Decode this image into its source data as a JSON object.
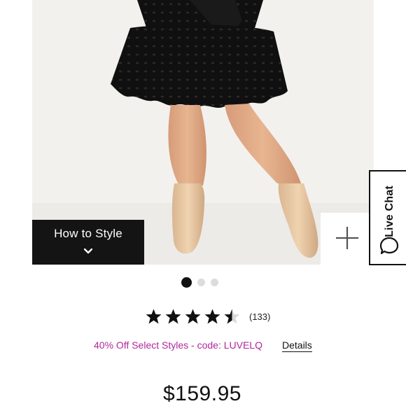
{
  "product_image": {
    "alt": "Model wearing black eyelet dress with nude boots"
  },
  "how_to_style": {
    "label": "How to Style",
    "icon": "chevron-down-icon"
  },
  "zoom": {
    "icon": "plus-icon"
  },
  "live_chat": {
    "label": "Live Chat",
    "icon": "chat-bubble-icon"
  },
  "carousel": {
    "count": 3,
    "active_index": 0
  },
  "rating": {
    "stars": 4.5,
    "max": 5,
    "review_count": "(133)"
  },
  "promo": {
    "text": "40% Off Select Styles - code: LUVELQ",
    "details_label": "Details",
    "color": "#b0279a"
  },
  "price": "$159.95"
}
